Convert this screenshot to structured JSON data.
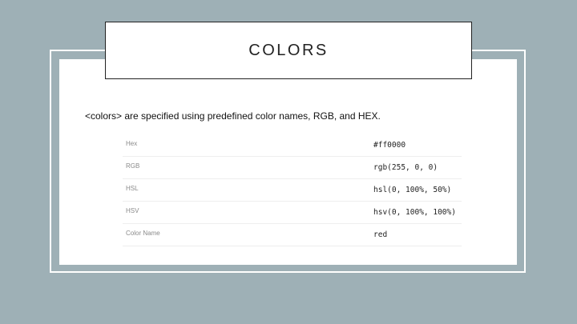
{
  "slide": {
    "title": "COLORS",
    "intro": "<colors> are specified using predefined color names, RGB,  and HEX."
  },
  "table": {
    "rows": [
      {
        "label": "Hex",
        "value": "#ff0000"
      },
      {
        "label": "RGB",
        "value": "rgb(255, 0, 0)"
      },
      {
        "label": "HSL",
        "value": "hsl(0, 100%, 50%)"
      },
      {
        "label": "HSV",
        "value": "hsv(0, 100%, 100%)"
      },
      {
        "label": "Color Name",
        "value": "red"
      }
    ]
  },
  "colors": {
    "background": "#9eb0b6",
    "panel": "#ffffff",
    "title_border": "#222222"
  }
}
